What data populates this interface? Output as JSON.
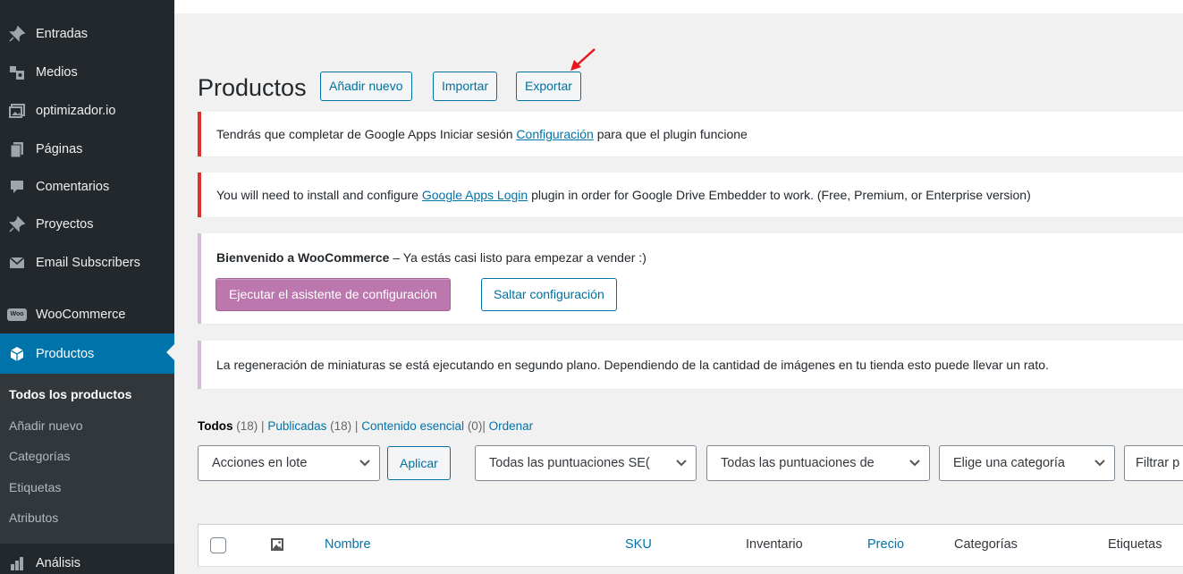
{
  "sidebar": {
    "items": [
      {
        "label": "Entradas",
        "icon": "pushpin-icon"
      },
      {
        "label": "Medios",
        "icon": "media-icon"
      },
      {
        "label": "optimizador.io",
        "icon": "gallery-icon"
      },
      {
        "label": "Páginas",
        "icon": "page-icon"
      },
      {
        "label": "Comentarios",
        "icon": "comment-icon"
      },
      {
        "label": "Proyectos",
        "icon": "pushpin-icon"
      },
      {
        "label": "Email Subscribers",
        "icon": "email-icon"
      },
      {
        "label": "WooCommerce",
        "icon": "woocommerce-icon",
        "icon_text": "Woo"
      },
      {
        "label": "Productos",
        "icon": "product-icon"
      },
      {
        "label": "Análisis",
        "icon": "bar-chart-icon"
      }
    ],
    "submenu": [
      "Todos los productos",
      "Añadir nuevo",
      "Categorías",
      "Etiquetas",
      "Atributos"
    ]
  },
  "header": {
    "title": "Productos",
    "buttons": [
      "Añadir nuevo",
      "Importar",
      "Exportar"
    ]
  },
  "notices": {
    "gapps": {
      "before": "Tendrás que completar de Google Apps Iniciar sesión ",
      "link": "Configuración",
      "after": " para que el plugin funcione"
    },
    "gdrive": {
      "before": "You will need to install and configure ",
      "link": "Google Apps Login",
      "after": " plugin in order for Google Drive Embedder to work. (Free, Premium, or Enterprise version)"
    },
    "woo": {
      "strong": "Bienvenido a WooCommerce",
      "rest": " – Ya estás casi listo para empezar a vender :)",
      "primary_button": "Ejecutar el asistente de configuración",
      "secondary_button": "Saltar configuración"
    },
    "regen": "La regeneración de miniaturas se está ejecutando en segundo plano. Dependiendo de la cantidad de imágenes en tu tienda esto puede llevar un rato."
  },
  "views": {
    "all_label": "Todos",
    "all_count": "(18)",
    "published_label": "Publicadas",
    "published_count": "(18)",
    "cornerstone_label": "Contenido esencial",
    "cornerstone_count": "(0)",
    "sort_label": "Ordenar",
    "sep": "|"
  },
  "filters": {
    "bulk_actions": "Acciones en lote",
    "apply": "Aplicar",
    "seo_scores": "Todas las puntuaciones SE(",
    "readability_scores": "Todas las puntuaciones de",
    "category": "Elige una categoría",
    "filter_partial": "Filtrar p"
  },
  "table": {
    "columns": [
      "Nombre",
      "SKU",
      "Inventario",
      "Precio",
      "Categorías",
      "Etiquetas"
    ]
  },
  "colors": {
    "sidebar_bg": "#23282d",
    "active_bg": "#0073aa",
    "notice_error": "#dc3232",
    "woo_purple": "#bb77ae",
    "link": "#0073aa",
    "annotation_arrow": "#e8161b"
  }
}
